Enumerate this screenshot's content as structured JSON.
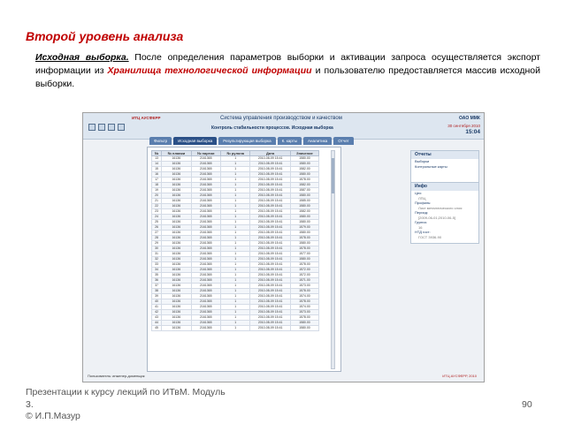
{
  "slide": {
    "title": "Второй уровень анализа",
    "intro": {
      "lead": "Исходная выборка.",
      "text1": " После определения параметров выборки и активации запроса осуществляется экспорт информации из ",
      "highlight": "Хранилища технологической информации",
      "text2": " и пользователю предоставляется массив исходной выборки."
    },
    "footer": {
      "line1": "Презентации к курсу лекций по ИТвМ. Модуль",
      "line2": "3.",
      "line3": "© И.П.Мазур"
    },
    "page_number": "90"
  },
  "screenshot": {
    "logo": "ИТЦ АУСФЕРР",
    "system_title": "Система управления производством и качеством",
    "form_title": "Контроль стабильности процессов. Исходная выборка",
    "company": "ОАО ММК",
    "date": "30 сентября 2010",
    "time": "15:04",
    "tabs": [
      {
        "label": "Фильтр"
      },
      {
        "label": "Исходная выборка"
      },
      {
        "label": "Результирующая выборка"
      },
      {
        "label": "К. карты"
      },
      {
        "label": "Аналитика"
      },
      {
        "label": "Отчет"
      }
    ],
    "table": {
      "headers": [
        "№",
        "№ плавки",
        "№ партии",
        "№ рулона",
        "Дата",
        "Значение"
      ],
      "rows": [
        [
          "13",
          "16136",
          "2161365",
          "1",
          "2010-08-09 15:41",
          "1580.00"
        ],
        [
          "14",
          "16136",
          "2161365",
          "1",
          "2010-08-09 15:41",
          "1580.00"
        ],
        [
          "15",
          "16136",
          "2161365",
          "1",
          "2010-08-09 15:41",
          "1582.00"
        ],
        [
          "16",
          "16136",
          "2161365",
          "1",
          "2010-08-09 15:41",
          "1580.00"
        ],
        [
          "17",
          "16136",
          "2161365",
          "1",
          "2010-08-09 15:41",
          "1578.00"
        ],
        [
          "18",
          "16136",
          "2161365",
          "1",
          "2010-08-09 15:41",
          "1582.00"
        ],
        [
          "19",
          "16136",
          "2161365",
          "1",
          "2010-08-09 15:41",
          "1587.00"
        ],
        [
          "20",
          "16136",
          "2161365",
          "1",
          "2010-08-09 15:41",
          "1580.00"
        ],
        [
          "21",
          "16136",
          "2161365",
          "1",
          "2010-08-09 15:41",
          "1585.00"
        ],
        [
          "22",
          "16136",
          "2161365",
          "1",
          "2010-08-09 15:41",
          "1580.00"
        ],
        [
          "23",
          "16136",
          "2161365",
          "1",
          "2010-08-09 15:41",
          "1582.00"
        ],
        [
          "24",
          "16136",
          "2161365",
          "1",
          "2010-08-09 15:41",
          "1580.00"
        ],
        [
          "25",
          "16136",
          "2161365",
          "1",
          "2010-08-09 15:41",
          "1580.00"
        ],
        [
          "26",
          "16136",
          "2161365",
          "1",
          "2010-08-09 15:41",
          "1579.00"
        ],
        [
          "27",
          "16136",
          "2161365",
          "1",
          "2010-08-09 15:41",
          "1580.00"
        ],
        [
          "28",
          "16136",
          "2161365",
          "1",
          "2010-08-09 15:41",
          "1578.00"
        ],
        [
          "29",
          "16136",
          "2161365",
          "1",
          "2010-08-09 15:41",
          "1580.00"
        ],
        [
          "30",
          "16136",
          "2161365",
          "1",
          "2010-08-09 15:41",
          "1578.00"
        ],
        [
          "31",
          "16136",
          "2161365",
          "1",
          "2010-08-09 15:41",
          "1577.00"
        ],
        [
          "32",
          "16136",
          "2161365",
          "1",
          "2010-08-09 15:41",
          "1580.00"
        ],
        [
          "33",
          "16136",
          "2161365",
          "1",
          "2010-08-09 15:41",
          "1578.00"
        ],
        [
          "34",
          "16136",
          "2161365",
          "1",
          "2010-08-09 15:41",
          "1572.00"
        ],
        [
          "35",
          "16136",
          "2161365",
          "1",
          "2010-08-09 15:41",
          "1572.00"
        ],
        [
          "36",
          "16136",
          "2161365",
          "1",
          "2010-08-09 15:41",
          "1571.00"
        ],
        [
          "37",
          "16136",
          "2161365",
          "1",
          "2010-08-09 15:41",
          "1573.00"
        ],
        [
          "38",
          "16136",
          "2161365",
          "1",
          "2010-08-09 15:41",
          "1578.00"
        ],
        [
          "39",
          "16136",
          "2161365",
          "1",
          "2010-08-09 15:41",
          "1574.00"
        ],
        [
          "40",
          "16136",
          "2161365",
          "1",
          "2010-08-09 15:41",
          "1578.00"
        ],
        [
          "41",
          "16136",
          "2161365",
          "1",
          "2010-08-09 15:41",
          "1574.00"
        ],
        [
          "42",
          "16136",
          "2161365",
          "1",
          "2010-08-09 15:41",
          "1573.00"
        ],
        [
          "43",
          "16136",
          "2161365",
          "1",
          "2010-08-09 15:41",
          "1578.00"
        ],
        [
          "44",
          "16136",
          "2161365",
          "1",
          "2010-08-09 15:41",
          "1580.00"
        ],
        [
          "45",
          "16136",
          "2161365",
          "1",
          "2010-08-09 15:41",
          "1580.00"
        ]
      ]
    },
    "reports": {
      "title": "Отчеты",
      "items": [
        "Выборки",
        "Контрольные карты"
      ]
    },
    "info": {
      "title": "Инфо",
      "lines": [
        {
          "text": "Цех:",
          "sub": false
        },
        {
          "text": "ЛПЦ",
          "sub": true
        },
        {
          "text": "Профиль:",
          "sub": false
        },
        {
          "text": "Лист металлического слоя",
          "sub": true
        },
        {
          "text": "Период:",
          "sub": false
        },
        {
          "text": "[2009-06-01;2010-06-5]",
          "sub": true
        },
        {
          "text": "Группа:",
          "sub": false
        },
        {
          "text": "16",
          "sub": true
        },
        {
          "text": "НТД гост:",
          "sub": false
        },
        {
          "text": "ГОСТ 3936-90",
          "sub": true
        }
      ]
    },
    "status": "Пользователь: инженер-доменщик",
    "footer": "ИТЦ АУСФЕРР, 2010"
  },
  "colors": {
    "accent_red": "#c00000",
    "tab_blue": "#5a7eae",
    "tab_active": "#2b5087"
  }
}
